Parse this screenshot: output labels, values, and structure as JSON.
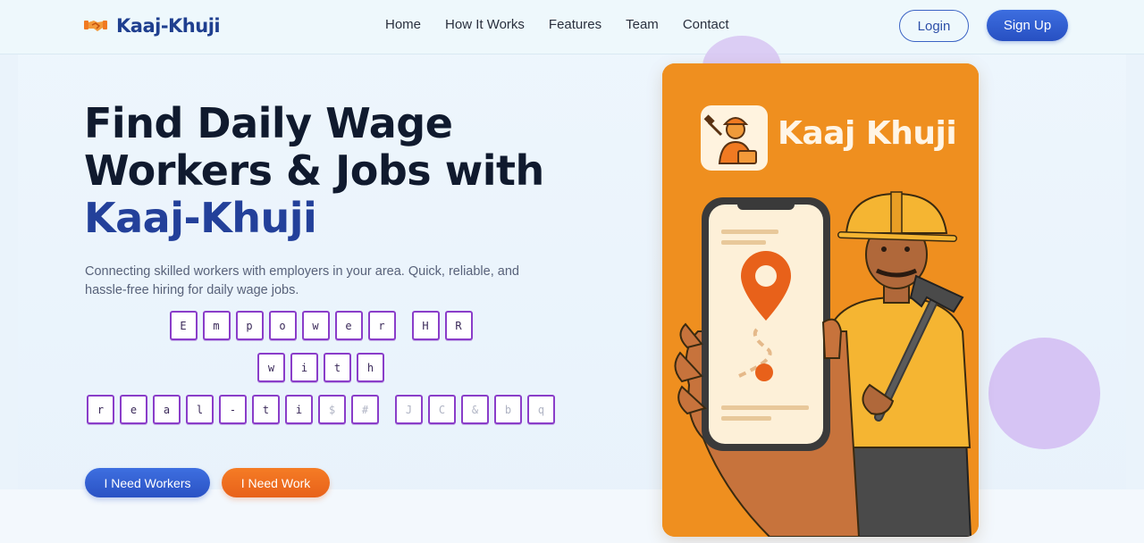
{
  "brand": {
    "name": "Kaaj-Khuji",
    "icon": "handshake-icon",
    "color": "#1f3f8f"
  },
  "nav": {
    "links": [
      {
        "label": "Home"
      },
      {
        "label": "How It Works"
      },
      {
        "label": "Features"
      },
      {
        "label": "Team"
      },
      {
        "label": "Contact"
      }
    ],
    "login_label": "Login",
    "signup_label": "Sign Up"
  },
  "hero": {
    "title_line1": "Find Daily Wage",
    "title_line2": "Workers & Jobs with",
    "title_brand": "Kaaj-Khuji",
    "subtitle": "Connecting skilled workers with employers in your area. Quick, reliable, and hassle-free hiring for daily wage jobs.",
    "typing_lines": [
      {
        "words": [
          [
            "E",
            "m",
            "p",
            "o",
            "w",
            "e",
            "r"
          ],
          [
            "H",
            "R"
          ]
        ]
      },
      {
        "words": [
          [
            "w",
            "i",
            "t",
            "h"
          ]
        ]
      },
      {
        "words": [
          [
            "r",
            "e",
            "a",
            "l",
            "-",
            "t",
            "i",
            "$",
            "#"
          ],
          [
            "J",
            "C",
            "&",
            "b",
            "q"
          ]
        ]
      }
    ],
    "dim_chars": [
      "$",
      "#",
      "J",
      "C",
      "&",
      "b",
      "q",
      "i"
    ],
    "btn_workers": "I Need Workers",
    "btn_work": "I Need Work"
  },
  "promo": {
    "app_name": "Kaaj Khuji",
    "icons": [
      "worker-logo-icon",
      "location-pin-icon",
      "hammer-icon"
    ]
  },
  "colors": {
    "primary": "#2a52c4",
    "accent_orange": "#e8611a",
    "card_orange": "#ef8f1f",
    "lavender": "#d6c4f4",
    "box_border": "#8a3dc9"
  }
}
